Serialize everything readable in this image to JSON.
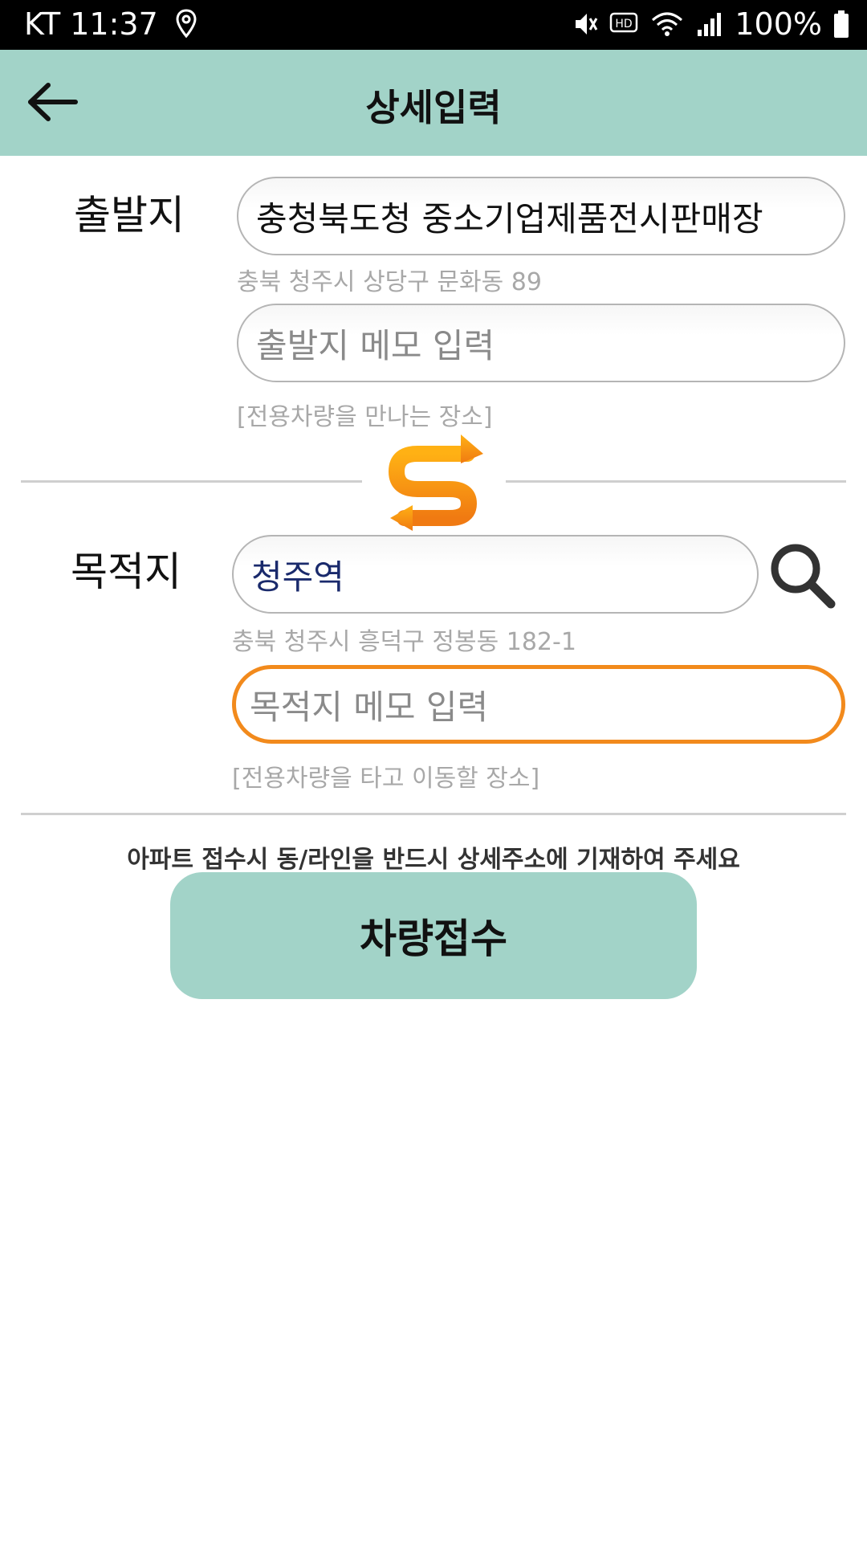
{
  "status_bar": {
    "carrier_time": "KT 11:37",
    "battery": "100%"
  },
  "header": {
    "title": "상세입력"
  },
  "origin": {
    "label": "출발지",
    "place_name": "충청북도청 중소기업제품전시판매장",
    "address": "충북 청주시 상당구 문화동 89",
    "memo_placeholder": "출발지 메모 입력",
    "memo_hint": "[전용차량을 만나는 장소]"
  },
  "destination": {
    "label": "목적지",
    "place_name": "청주역",
    "address": "충북 청주시 흥덕구 정봉동 182-1",
    "memo_placeholder": "목적지 메모 입력",
    "memo_hint": "[전용차량을 타고 이동할 장소]"
  },
  "notice": "아파트 접수시 동/라인을 반드시 상세주소에 기재하여 주세요",
  "submit_label": "차량접수",
  "colors": {
    "header_bg": "#a2d3c8",
    "accent_orange": "#f28a1c",
    "destination_text": "#1a2a6c"
  }
}
